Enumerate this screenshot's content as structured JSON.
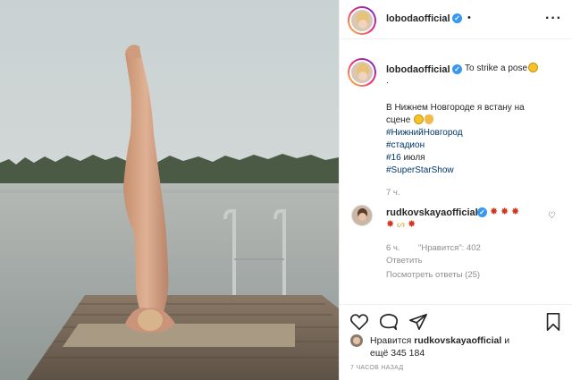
{
  "post": {
    "author": "lobodaofficial",
    "verified": true,
    "header_dot": "•"
  },
  "caption": {
    "author": "lobodaofficial",
    "text": "To strike a pose",
    "dot_line": ".",
    "line1": "В Нижнем Новгороде я встану на",
    "line2": "сцене",
    "hashtags": [
      "#НижнийНовгород",
      "#стадион"
    ],
    "date_tag": "#16",
    "date_word": "июля",
    "show_tag": "#SuperStarShow",
    "time_ago": "7 ч."
  },
  "comment": {
    "author": "rudkovskayaofficial",
    "time_ago": "6 ч.",
    "likes_label": "\"Нравится\": 402",
    "reply_label": "Ответить",
    "view_replies": "Посмотреть ответы (25)"
  },
  "likes": {
    "prefix": "Нравится",
    "user": "rudkovskayaofficial",
    "suffix": "и",
    "line2": "ещё 345 184"
  },
  "timestamp": "7 ЧАСОВ НАЗАД",
  "icons": {
    "more": "more-horizontal-icon",
    "like": "heart-icon",
    "comment": "comment-icon",
    "share": "paper-plane-icon",
    "save": "bookmark-icon"
  },
  "colors": {
    "link": "#00376b",
    "verified": "#3897f0",
    "muted": "#8e8e8e"
  }
}
